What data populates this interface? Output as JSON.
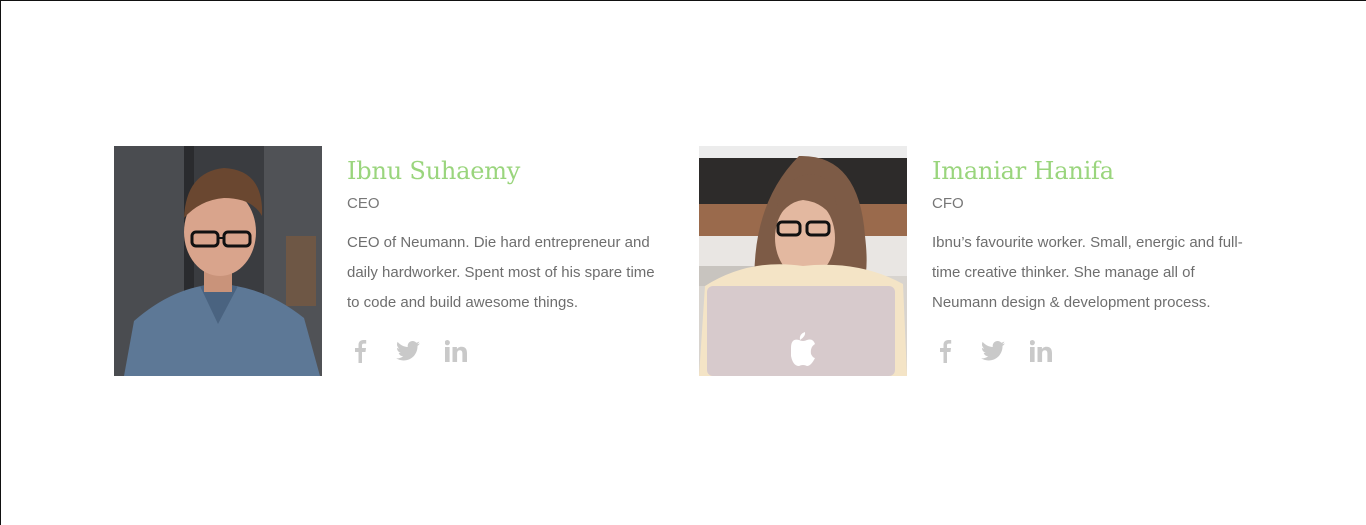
{
  "team": [
    {
      "name": "Ibnu Suhaemy",
      "role": "CEO",
      "bio": "CEO of Neumann. Die hard entrepreneur and daily hardworker. Spent most of his spare time to code and build awesome things.",
      "photo": "portrait-man-glasses-denim-shirt",
      "social": [
        "facebook-icon",
        "twitter-icon",
        "linkedin-icon"
      ]
    },
    {
      "name": "Imaniar Hanifa",
      "role": "CFO",
      "bio": "Ibnu’s favourite worker. Small, energic and full-time creative thinker. She manage all of Neumann design & development process.",
      "photo": "portrait-woman-glasses-laptop",
      "social": [
        "facebook-icon",
        "twitter-icon",
        "linkedin-icon"
      ]
    }
  ],
  "colors": {
    "accent": "#9ad57d",
    "text": "#6e6e6e",
    "role": "#777777",
    "icon": "#c9c9c9"
  }
}
